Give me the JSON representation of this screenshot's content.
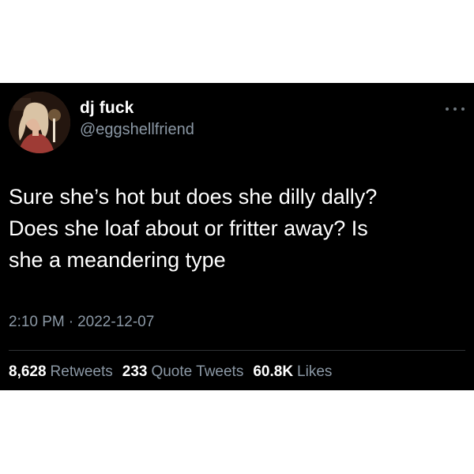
{
  "tweet": {
    "display_name": "dj fuck",
    "handle": "@eggshellfriend",
    "text": "Sure she’s hot but does she dilly dally?\nDoes she loaf about or fritter away? Is\nshe a meandering type",
    "time": "2:10 PM",
    "separator": "·",
    "date": "2022-12-07",
    "avatar_icon": "profile-photo",
    "more_icon": "more-horizontal-icon"
  },
  "stats": {
    "retweets_count": "8,628",
    "retweets_label": "Retweets",
    "quotes_count": "233",
    "quotes_label": "Quote Tweets",
    "likes_count": "60.8K",
    "likes_label": "Likes"
  },
  "colors": {
    "background": "#000000",
    "text_primary": "#ffffff",
    "text_secondary": "#8b98a5",
    "divider": "#2f3336"
  }
}
